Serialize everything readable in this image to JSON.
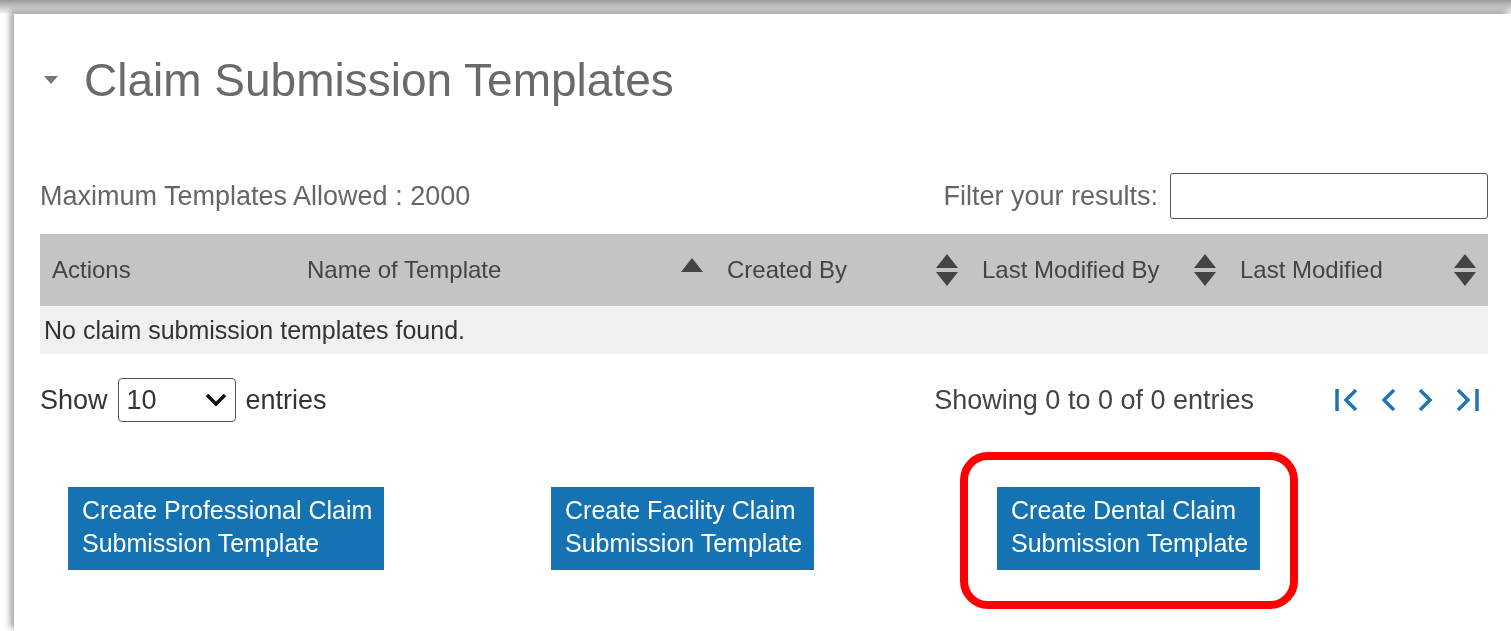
{
  "section": {
    "title": "Claim Submission Templates",
    "expanded": true
  },
  "max_templates": "Maximum Templates Allowed : 2000",
  "filter": {
    "label": "Filter your results:"
  },
  "table": {
    "columns": [
      {
        "label": "Actions",
        "sortable": false
      },
      {
        "label": "Name of Template",
        "sortable": true,
        "sorted": true
      },
      {
        "label": "Created By",
        "sortable": true,
        "sorted": false
      },
      {
        "label": "Last Modified By",
        "sortable": true,
        "sorted": false
      },
      {
        "label": "Last Modified",
        "sortable": true,
        "sorted": false
      }
    ],
    "empty_message": "No claim submission templates found."
  },
  "length": {
    "prefix": "Show",
    "value": "10",
    "suffix": "entries"
  },
  "info": "Showing 0 to 0 of 0 entries",
  "buttons": [
    {
      "lines": [
        "Create Professional Claim",
        "Submission Template"
      ],
      "highlighted": false
    },
    {
      "lines": [
        "Create Facility Claim",
        "Submission Template"
      ],
      "highlighted": false
    },
    {
      "lines": [
        "Create Dental Claim",
        "Submission Template"
      ],
      "highlighted": true
    }
  ]
}
